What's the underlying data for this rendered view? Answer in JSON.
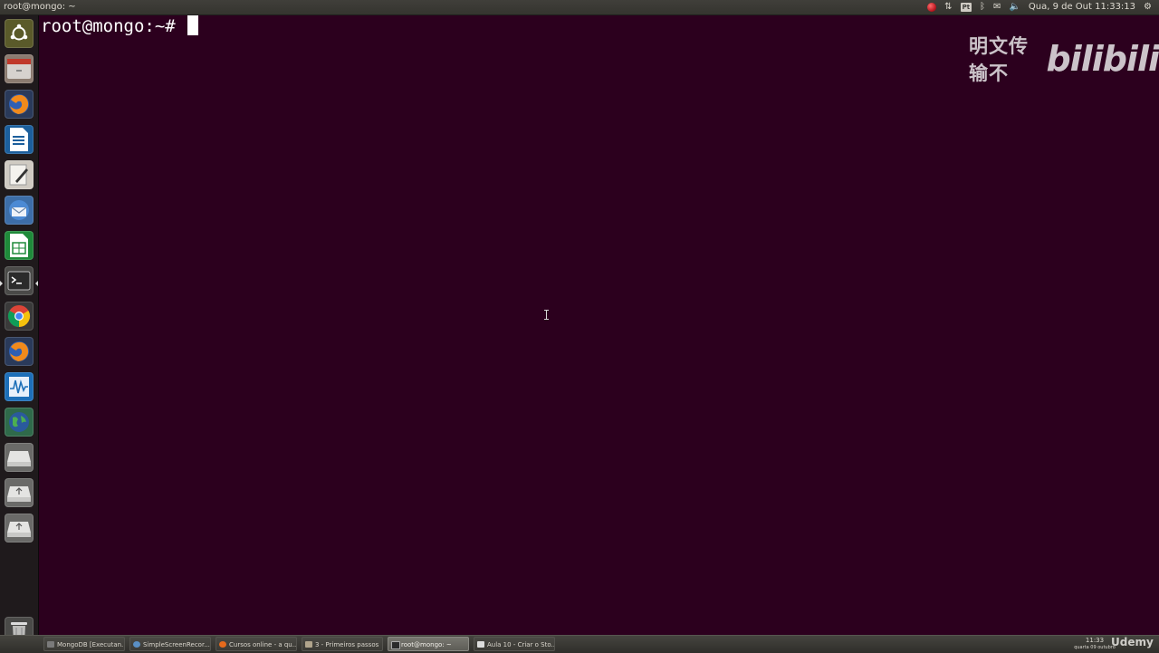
{
  "top_panel": {
    "window_title": "root@mongo: ~",
    "indicators": {
      "recorder_icon": "recording-dot-icon",
      "network_icon": "network-updown-icon",
      "keyboard_badge": "Pt",
      "bluetooth_icon": "bluetooth-icon",
      "mail_icon": "envelope-icon",
      "volume_icon": "speaker-icon",
      "datetime": "Qua, 9 de Out 11:33:13",
      "session_icon": "gear-icon"
    }
  },
  "launcher": {
    "items": [
      {
        "name": "dash-home",
        "icon": "ubuntu-logo-icon"
      },
      {
        "name": "files",
        "icon": "file-cabinet-icon"
      },
      {
        "name": "firefox",
        "icon": "firefox-icon"
      },
      {
        "name": "libreoffice-writer",
        "icon": "writer-icon"
      },
      {
        "name": "text-editor",
        "icon": "text-editor-icon"
      },
      {
        "name": "thunderbird",
        "icon": "mail-client-icon"
      },
      {
        "name": "libreoffice-calc",
        "icon": "calc-icon"
      },
      {
        "name": "terminal",
        "icon": "terminal-icon"
      },
      {
        "name": "chrome",
        "icon": "chrome-icon"
      },
      {
        "name": "firefox-2",
        "icon": "firefox-icon"
      },
      {
        "name": "system-monitor",
        "icon": "monitor-graph-icon"
      },
      {
        "name": "globe-app",
        "icon": "globe-icon"
      },
      {
        "name": "drive-1",
        "icon": "drive-icon"
      },
      {
        "name": "usb-drive-1",
        "icon": "usb-drive-icon"
      },
      {
        "name": "usb-drive-2",
        "icon": "usb-drive-icon"
      },
      {
        "name": "trash",
        "icon": "trash-icon"
      }
    ]
  },
  "terminal": {
    "prompt": "root@mongo:~# "
  },
  "watermark": {
    "chinese_text": "明文传输不",
    "logo_text": "bilibili"
  },
  "taskbar": {
    "items": [
      {
        "label": "MongoDB [Executan...",
        "icon_color": "#7a7a7a"
      },
      {
        "label": "SimpleScreenRecor...",
        "icon_color": "#5a8fc4"
      },
      {
        "label": "Cursos online - a qu...",
        "icon_color": "#e66a1c"
      },
      {
        "label": "3 - Primeiros passos",
        "icon_color": "#b0a48c"
      },
      {
        "label": "root@mongo: ~",
        "icon_color": "#2b2b2b"
      },
      {
        "label": "Aula 10 - Criar o Sto...",
        "icon_color": "#dcdcdc"
      }
    ],
    "active_index": 4,
    "clock_time": "11:33",
    "clock_date": "quarta 09 outubro",
    "brand": "Udemy"
  }
}
